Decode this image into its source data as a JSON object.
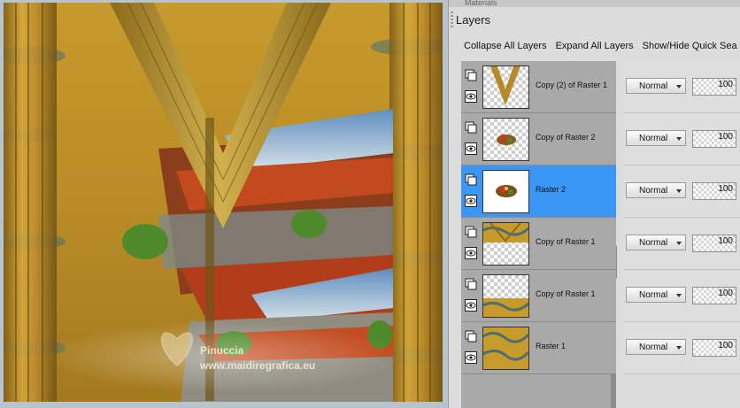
{
  "panel": {
    "top_label": "Materials",
    "title": "Layers",
    "toolbar": {
      "collapse_all": "Collapse All Layers",
      "expand_all": "Expand All Layers",
      "show_hide_quick_search": "Show/Hide Quick Sea"
    }
  },
  "watermark": {
    "name": "Pinuccia",
    "url": "www.maidiregrafica.eu"
  },
  "layers": [
    {
      "name": "Copy (2) of Raster 1",
      "blend": "Normal",
      "opacity": "100",
      "selected": false,
      "thumbnail": "v-shape-on-transparency"
    },
    {
      "name": "Copy of Raster 2",
      "blend": "Normal",
      "opacity": "100",
      "selected": false,
      "thumbnail": "small-ornament-on-transparency"
    },
    {
      "name": "Raster 2",
      "blend": "Normal",
      "opacity": "100",
      "selected": true,
      "thumbnail": "small-ornament"
    },
    {
      "name": "Copy of Raster 1",
      "blend": "Normal",
      "opacity": "100",
      "selected": false,
      "thumbnail": "gold-top-half"
    },
    {
      "name": "Copy of Raster 1",
      "blend": "Normal",
      "opacity": "100",
      "selected": false,
      "thumbnail": "gold-bottom-half"
    },
    {
      "name": "Raster 1",
      "blend": "Normal",
      "opacity": "100",
      "selected": false,
      "thumbnail": "gold-swirl-full"
    }
  ],
  "icons": {
    "layer_link": "layers-link-icon",
    "visibility": "eye-icon",
    "dropdown": "chevron-down-icon",
    "splitter": "splitter-handle-icon"
  },
  "colors": {
    "selection": "#3a97f5",
    "row": "#a9a9a9",
    "gold": "#c9a22d"
  }
}
